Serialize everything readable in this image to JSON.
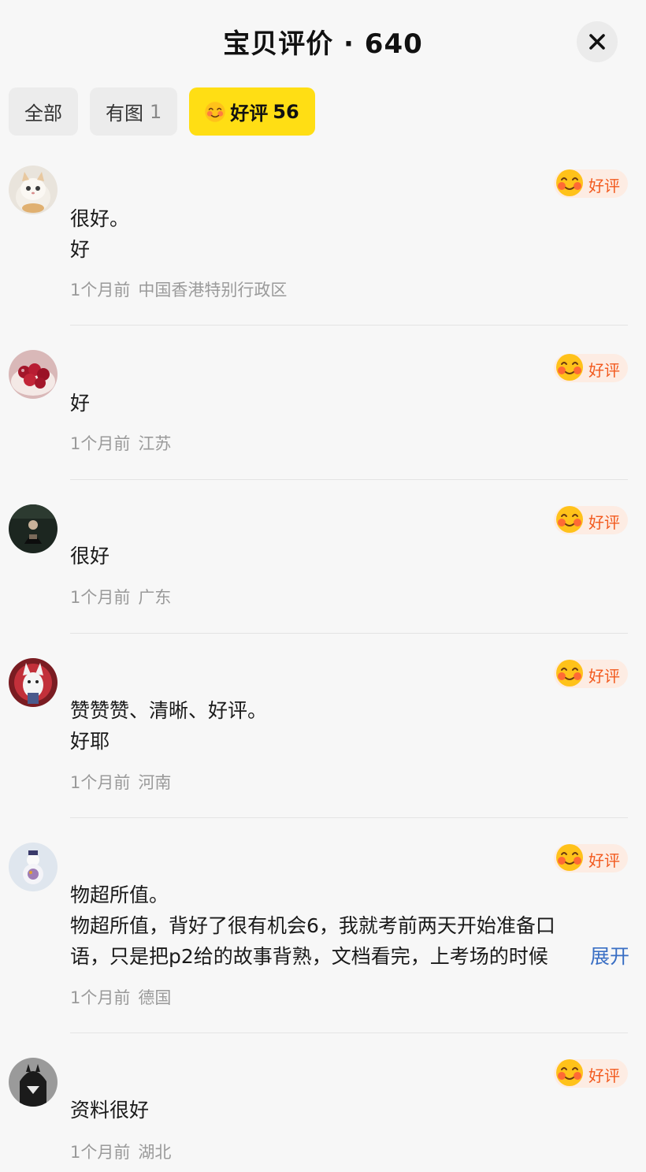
{
  "header": {
    "title": "宝贝评价 · 640",
    "close_icon": "close-icon"
  },
  "tabs": [
    {
      "label": "全部",
      "count": ""
    },
    {
      "label": "有图",
      "count": "1"
    },
    {
      "label": "好评",
      "count": "56",
      "icon": "smiling-face-icon",
      "active": true
    }
  ],
  "badge_label": "好评",
  "reviews": [
    {
      "lines": [
        "很好。",
        "好"
      ],
      "time": "1个月前",
      "location": "中国香港特别行政区",
      "avatar": "cat-avatar"
    },
    {
      "lines": [
        "好"
      ],
      "time": "1个月前",
      "location": "江苏",
      "avatar": "cherries-avatar"
    },
    {
      "lines": [
        "很好"
      ],
      "time": "1个月前",
      "location": "广东",
      "avatar": "dark-portrait-avatar"
    },
    {
      "lines": [
        "赞赞赞、清晰、好评。",
        "好耶"
      ],
      "time": "1个月前",
      "location": "河南",
      "avatar": "wolf-avatar"
    },
    {
      "lines": [
        "物超所值。",
        "物超所值，背好了很有机会6，我就考前两天开始准备口",
        "语，只是把p2给的故事背熟，文档看完，上考场的时候"
      ],
      "expand_label": "展开",
      "time": "1个月前",
      "location": "德国",
      "avatar": "snowman-avatar"
    },
    {
      "lines": [
        "资料很好"
      ],
      "time": "1个月前",
      "location": "湖北",
      "avatar": "masked-figure-avatar"
    }
  ],
  "colors": {
    "accent_yellow": "#ffde14",
    "badge_text": "#f25a1e",
    "badge_bg": "#fdece3",
    "link_blue": "#3a6fc4",
    "meta_gray": "#9a9a9a"
  }
}
